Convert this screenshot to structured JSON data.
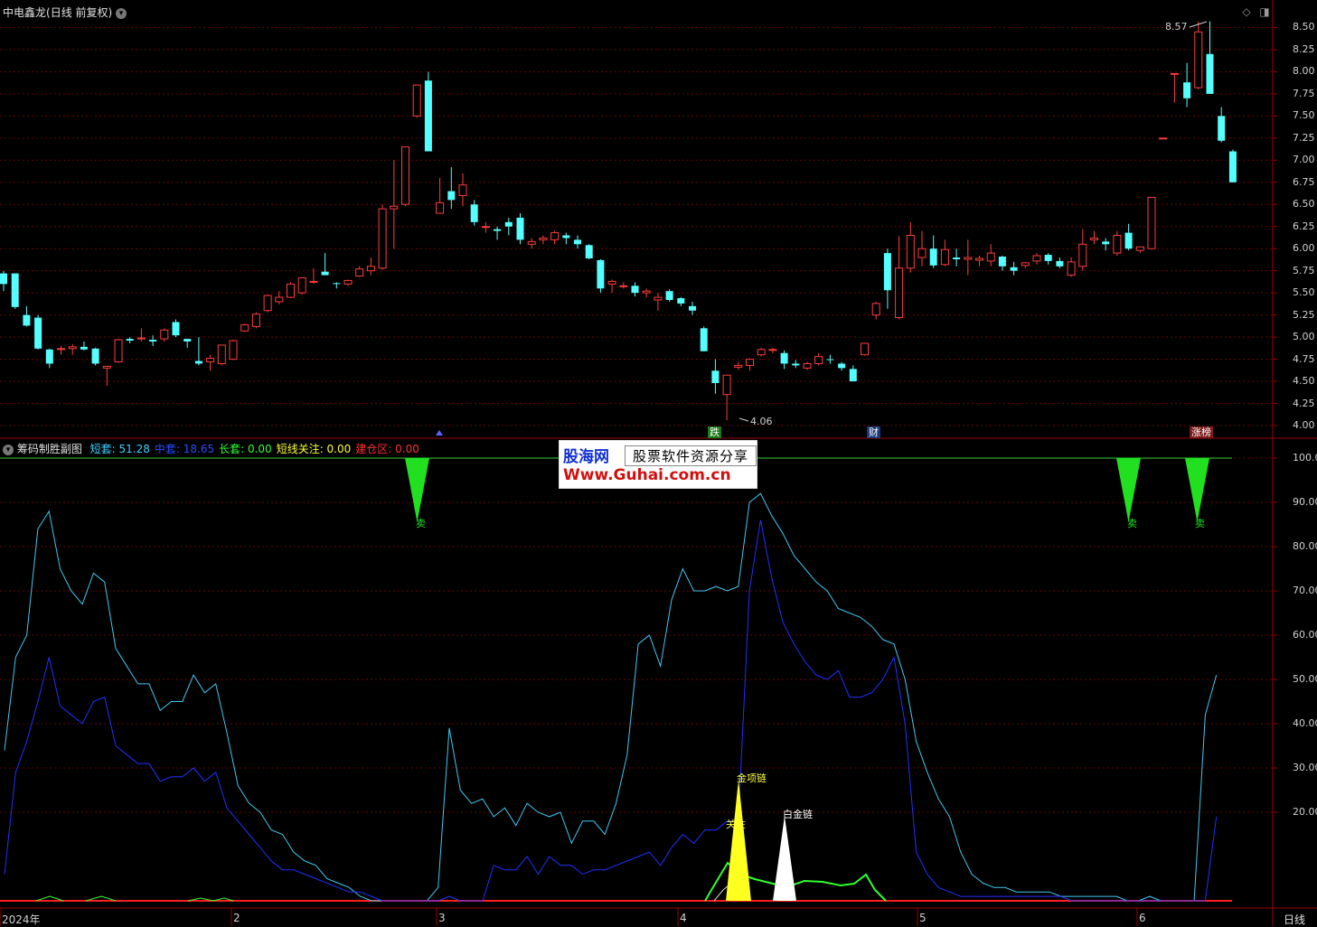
{
  "main": {
    "stock_name": "中电鑫龙",
    "period": "(日线 前复权)",
    "high_note": "8.57",
    "low_note": "4.06",
    "badges": [
      {
        "text": "跌",
        "color": "#ffffff",
        "bg": "#1a7a1a"
      },
      {
        "text": "财",
        "color": "#ffffff",
        "bg": "#1a3a7a"
      },
      {
        "text": "涨榜",
        "color": "#ffffff",
        "bg": "#7a1a1a"
      }
    ],
    "price_ticks": [
      "8.50",
      "8.25",
      "8.00",
      "7.75",
      "7.50",
      "7.25",
      "7.00",
      "6.75",
      "6.50",
      "6.25",
      "6.00",
      "5.75",
      "5.50",
      "5.25",
      "5.00",
      "4.75",
      "4.50",
      "4.25",
      "4.00"
    ]
  },
  "indicator": {
    "name": "筹码制胜副图",
    "fields": [
      {
        "label": "短套:",
        "value": "51.28",
        "color": "#40d0ff"
      },
      {
        "label": "中套:",
        "value": "18.65",
        "color": "#2a4cff"
      },
      {
        "label": "长套:",
        "value": "0.00",
        "color": "#30ff30"
      },
      {
        "label": "短线关注:",
        "value": "0.00",
        "color": "#ffff30"
      },
      {
        "label": "建仓区:",
        "value": "0.00",
        "color": "#ff3030"
      }
    ],
    "ticks": [
      "100.0",
      "90.00",
      "80.00",
      "70.00",
      "60.00",
      "50.00",
      "40.00",
      "30.00",
      "20.00"
    ],
    "sell_label": "卖",
    "gold_label": "金项链",
    "watch_label": "关注",
    "white_label": "白金链"
  },
  "watermark": {
    "brand": "股海网",
    "slogan": "股票软件资源分享",
    "url": "Www.Guhai.com.cn"
  },
  "dates": [
    "2024年",
    "2",
    "3",
    "4",
    "5",
    "6"
  ],
  "period_button": "日线",
  "colors": {
    "up": "#ff3c3c",
    "down": "#54ffff",
    "grid": "#7a0000",
    "axis": "#a00000"
  }
}
